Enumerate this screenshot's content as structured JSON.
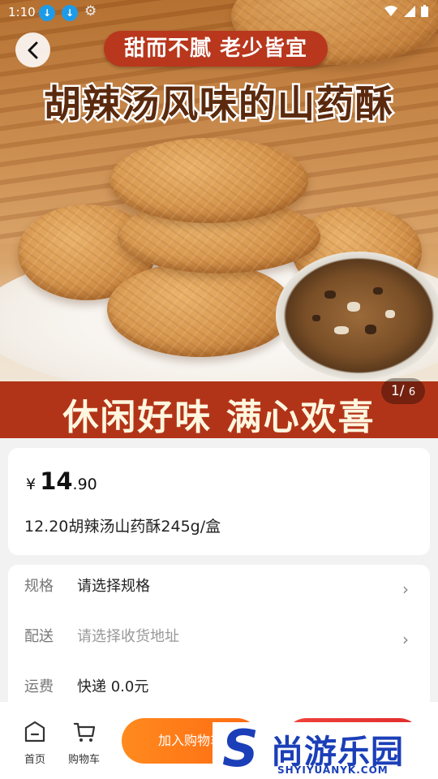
{
  "status_bar": {
    "time": "1:10",
    "download_glyph": "↓"
  },
  "gallery": {
    "pill_text": "甜而不腻 老少皆宜",
    "headline": "胡辣汤风味的山药酥",
    "banner_text": "休闲好味 满心欢喜",
    "counter_current": "1",
    "counter_total": "6"
  },
  "product": {
    "currency": "¥",
    "price_int": "14",
    "price_dec": ".90",
    "title": "12.20胡辣汤山药酥245g/盒"
  },
  "specs": [
    {
      "label": "规格",
      "value": "请选择规格",
      "placeholder": false,
      "chevron": "›"
    },
    {
      "label": "配送",
      "value": "请选择收货地址",
      "placeholder": true,
      "chevron": "›"
    },
    {
      "label": "运费",
      "value": "快递 0.0元",
      "placeholder": false,
      "chevron": ""
    }
  ],
  "bottom_bar": {
    "home_label": "首页",
    "cart_label": "购物车",
    "add_to_cart": "加入购物车"
  },
  "watermark": {
    "brand": "尚游乐园",
    "logo_letter": "S",
    "url": "SHYIYUANYK.COM"
  },
  "colors": {
    "accent": "#ff6a12",
    "buy": "#e02d2d",
    "banner": "#b23418"
  },
  "icons": [
    "back-arrow-icon",
    "home-icon",
    "cart-icon",
    "chevron-right-icon",
    "download-icon",
    "gear-icon",
    "wifi-icon",
    "signal-icon",
    "battery-icon"
  ]
}
